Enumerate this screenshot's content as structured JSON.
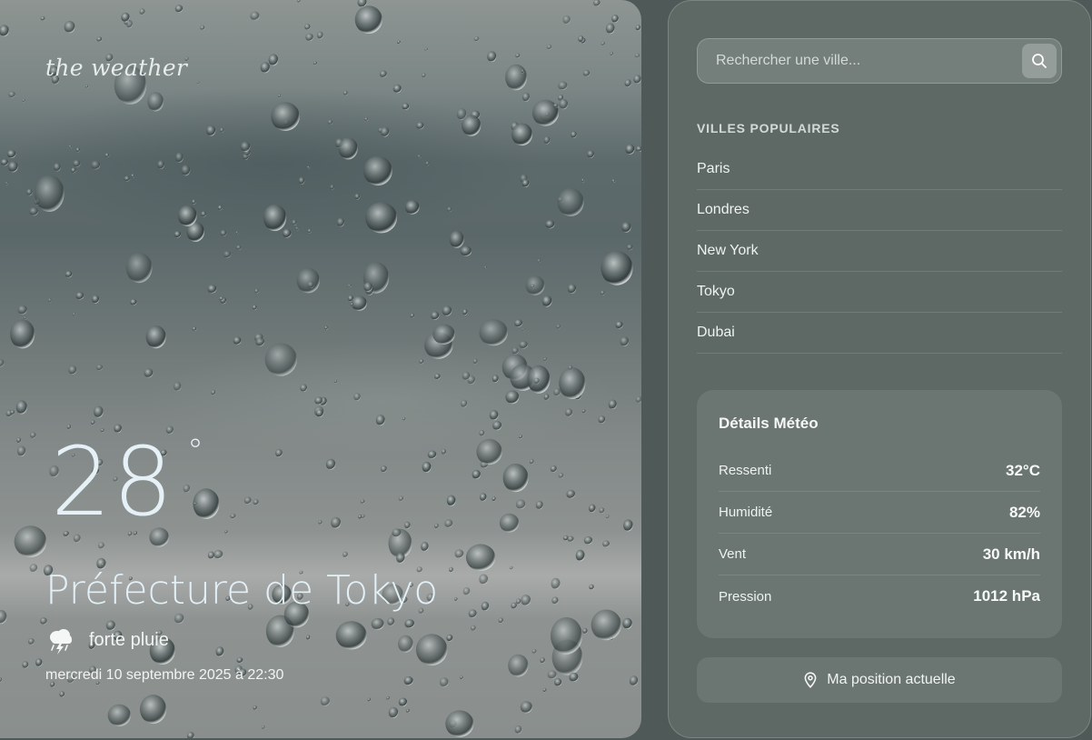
{
  "hero": {
    "brand": "the weather",
    "temperature": "28",
    "degree_symbol": "°",
    "city": "Préfecture de Tokyo",
    "condition": "forte pluie",
    "condition_icon": "thunder-rain-cloud-icon",
    "datetime": "mercredi 10 septembre 2025 à 22:30"
  },
  "search": {
    "placeholder": "Rechercher une ville...",
    "button_icon": "search-icon"
  },
  "popular": {
    "title": "VILLES POPULAIRES",
    "cities": [
      "Paris",
      "Londres",
      "New York",
      "Tokyo",
      "Dubai"
    ]
  },
  "details": {
    "title": "Détails Météo",
    "rows": [
      {
        "label": "Ressenti",
        "value": "32°C"
      },
      {
        "label": "Humidité",
        "value": "82%"
      },
      {
        "label": "Vent",
        "value": "30 km/h"
      },
      {
        "label": "Pression",
        "value": "1012 hPa"
      }
    ]
  },
  "location_button": {
    "label": "Ma position actuelle",
    "icon": "map-pin-icon"
  }
}
